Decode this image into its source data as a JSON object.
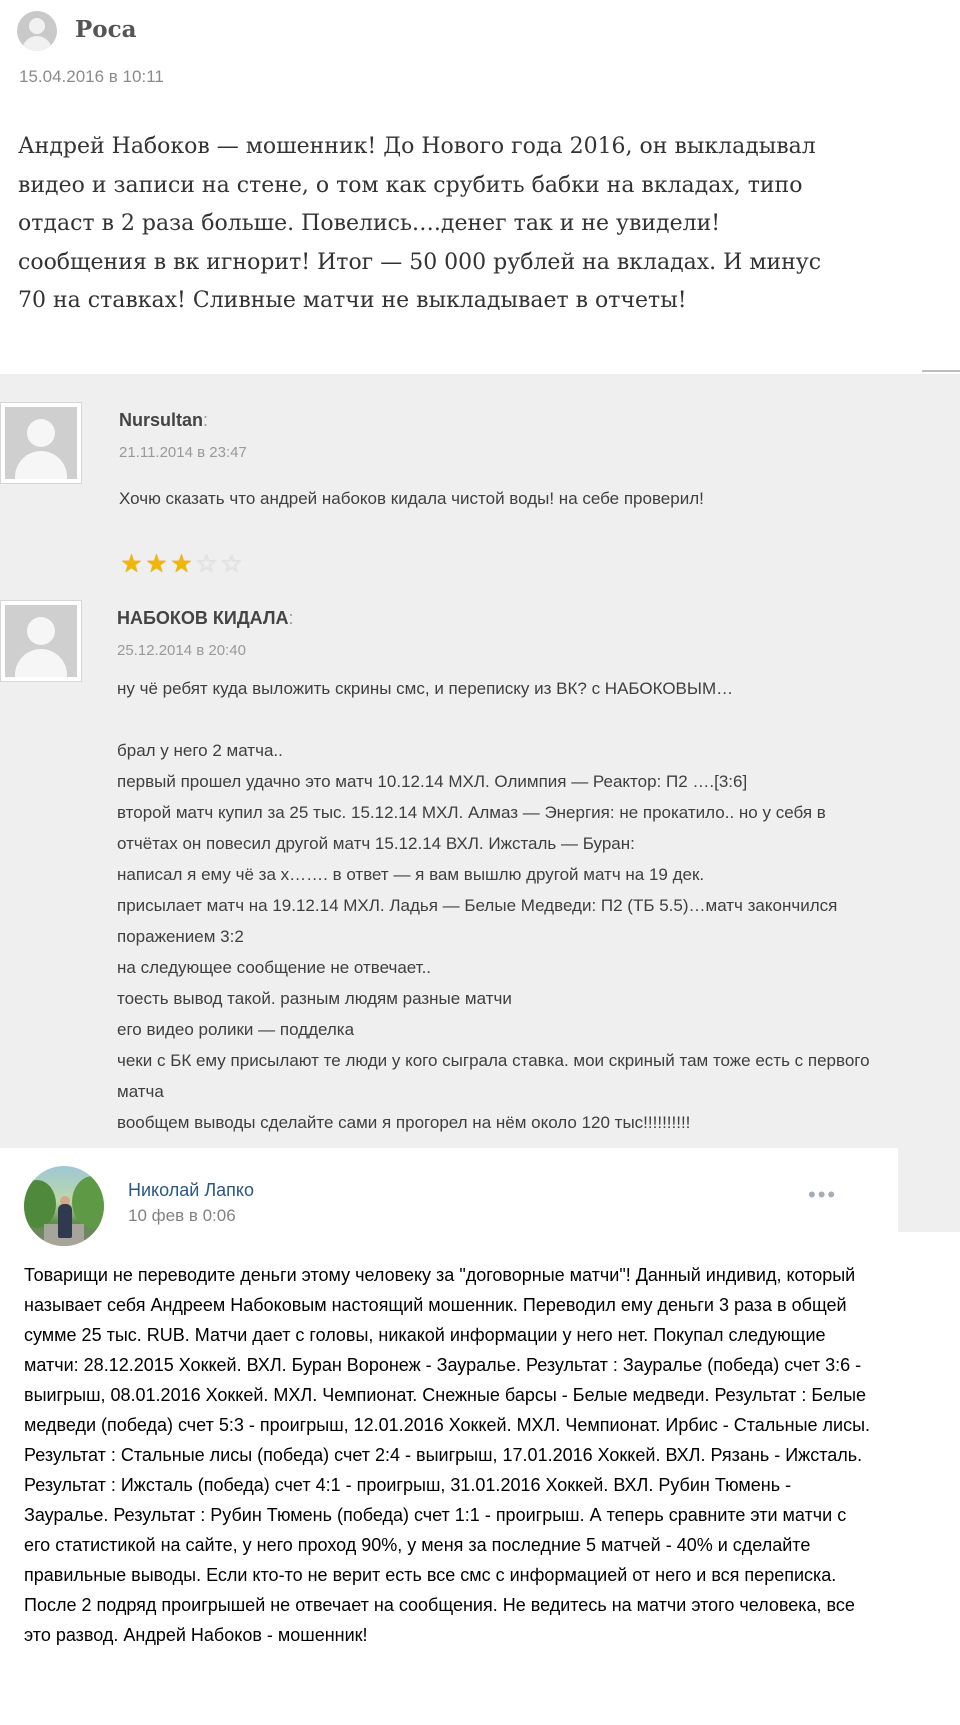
{
  "comment1": {
    "author": "Роса",
    "date": "15.04.2016 в 10:11",
    "text": "Андрей Набоков — мошенник! До Нового года 2016, он выкладывал видео и записи на стене, о том как срубить бабки на вкладах, типо отдаст в 2 раза больше. Повелись….денег так и не увидели! сообщения в вк игнорит! Итог — 50 000 рублей на вкладах. И минус 70 на ставках! Сливные матчи не выкладывает в отчеты!"
  },
  "comment2": {
    "author": "Nursultan",
    "colon": ":",
    "date": "21.11.2014 в 23:47",
    "text": "Хочю сказать что андрей набоков кидала чистой воды! на себе проверил!",
    "rating": {
      "stars_filled": 3,
      "stars_total": 5,
      "on_glyph": "★",
      "off_glyph": "☆"
    }
  },
  "comment3": {
    "author": "НАБОКОВ КИДАЛА",
    "colon": ":",
    "date": "25.12.2014 в 20:40",
    "lines": [
      "ну чё ребят куда выложить скрины смс, и переписку из ВК? с НАБОКОВЫМ…",
      "",
      "брал у него 2 матча..",
      "первый прошел удачно это матч 10.12.14 МХЛ. Олимпия — Реактор: П2 ….[3:6]",
      "второй матч купил за 25 тыс. 15.12.14 МХЛ. Алмаз — Энергия: не прокатило.. но у себя в",
      "отчётах он повесил другой матч 15.12.14 ВХЛ. Ижсталь — Буран:",
      "написал я ему чё за х……. в ответ — я вам вышлю другой матч на 19 дек.",
      "присылает матч на 19.12.14 МХЛ. Ладья — Белые Медведи: П2 (ТБ 5.5)…матч закончился",
      "поражением 3:2",
      "на следующее сообщение не отвечает..",
      "тоесть вывод такой. разным людям разные матчи",
      "его видео ролики — подделка",
      "чеки с БК ему присылают те люди у кого сыграла ставка. мои скриный там тоже есть с первого",
      "матча",
      "вообщем выводы сделайте сами я прогорел на нём около 120 тыс!!!!!!!!!!"
    ]
  },
  "vk_post": {
    "author": "Николай Лапко",
    "date": "10 фев в 0:06",
    "menu": "•••",
    "text": "Товарищи не переводите деньги этому человеку за \"договорные матчи\"! Данный индивид, который называет себя Андреем Набоковым настоящий мошенник. Переводил ему деньги 3 раза в общей сумме 25 тыс. RUB. Матчи дает с головы, никакой информации у него нет. Покупал следующие матчи: 28.12.2015 Хоккей. ВХЛ. Буран Воронеж - Зауралье. Результат : Зауралье (победа) счет 3:6 - выигрыш, 08.01.2016 Хоккей. МХЛ. Чемпионат. Снежные барсы - Белые медведи. Результат : Белые медведи (победа) счет 5:3 - проигрыш, 12.01.2016 Хоккей. МХЛ. Чемпионат. Ирбис - Стальные лисы. Результат : Стальные лисы (победа) счет 2:4 - выигрыш, 17.01.2016 Хоккей. ВХЛ. Рязань - Ижсталь. Результат : Ижсталь (победа) счет 4:1 - проигрыш, 31.01.2016 Хоккей. ВХЛ. Рубин Тюмень - Зауралье. Результат : Рубин Тюмень (победа) счет 1:1 - проигрыш. А теперь сравните эти матчи с его статистикой на сайте, у него проход 90%, у меня за последние 5 матчей - 40% и сделайте правильные выводы. Если кто-то не верит есть все смс с информацией от него и вся переписка. После 2 подряд проигрышей не отвечает на сообщения. Не ведитесь на матчи этого человека, все это развод. Андрей Набоков - мошенник!"
  }
}
